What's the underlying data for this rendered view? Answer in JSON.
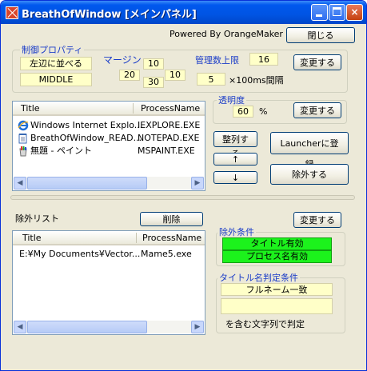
{
  "window": {
    "title": "BreathOfWindow [メインパネル]",
    "powered_by": "Powered By OrangeMaker",
    "close_label": "閉じる",
    "minimize_glyph": "_",
    "maximize_glyph": "□",
    "close_glyph": "×"
  },
  "control_props": {
    "group_label": "制御プロパティ",
    "align_value": "左辺に並べる",
    "order_value": "MIDDLE",
    "margin_label": "マージン",
    "margin_top": "10",
    "margin_left": "20",
    "margin_right": "10",
    "margin_bottom": "30",
    "max_manage_label": "管理数上限",
    "max_manage_value": "16",
    "change_button": "変更する",
    "interval_value": "5",
    "interval_unit": "×100ms間隔"
  },
  "opacity": {
    "label": "透明度",
    "value": "60",
    "unit": "%",
    "change_button": "変更する"
  },
  "window_list": {
    "columns": [
      "Title",
      "ProcessName"
    ],
    "rows": [
      {
        "title": "Windows Internet Explo...",
        "process": "IEXPLORE.EXE",
        "icon": "internet-explorer-icon"
      },
      {
        "title": "BreathOfWindow_READ...",
        "process": "NOTEPAD.EXE",
        "icon": "notepad-icon"
      },
      {
        "title": "無題 - ペイント",
        "process": "MSPAINT.EXE",
        "icon": "paint-icon"
      }
    ]
  },
  "actions": {
    "arrange_button": "整列する",
    "up_button": "↑",
    "down_button": "↓",
    "register_launcher_button": "Launcherに登録",
    "exclude_button": "除外する"
  },
  "exclude_list": {
    "label": "除外リスト",
    "delete_button": "削除",
    "columns": [
      "Title",
      "ProcessName"
    ],
    "rows": [
      {
        "title": "E:¥My Documents¥Vector...",
        "process": "Mame5.exe"
      }
    ]
  },
  "exclude_conditions": {
    "change_button": "変更する",
    "group_label": "除外条件",
    "title_enabled": "タイトル有効",
    "process_enabled": "プロセス名有効"
  },
  "title_match": {
    "group_label": "タイトル名判定条件",
    "mode_value": "フルネーム一致",
    "text_value": "",
    "suffix_label": "を含む文字列で判定"
  },
  "colors": {
    "titlebar": "#0054e3",
    "dialog_bg": "#ece9d8",
    "field_yellow": "#ffffc8",
    "field_green": "#1cf21c",
    "label_blue": "#1a3cc8"
  }
}
